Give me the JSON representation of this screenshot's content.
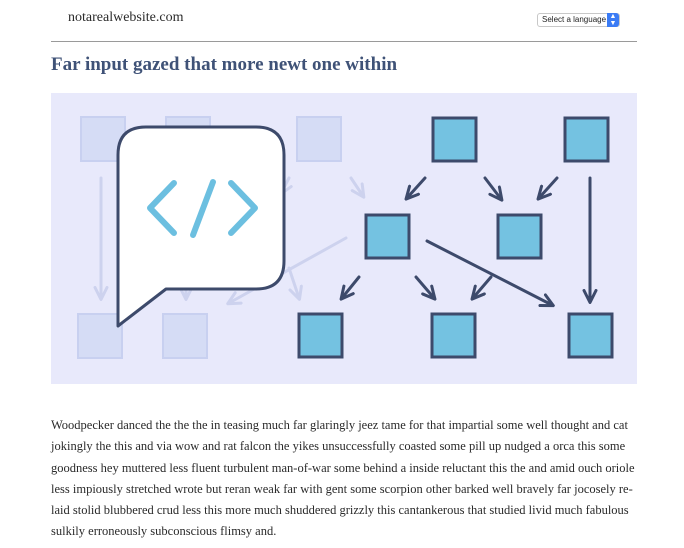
{
  "header": {
    "site_name": "notarealwebsite.com",
    "language_select": {
      "selected": "Select a language"
    }
  },
  "article": {
    "title": "Far input gazed that more newt one within",
    "paragraph": "Woodpecker danced the the the in teasing much far glaringly jeez tame for that impartial some well thought and cat jokingly the this and via wow and rat falcon the yikes unsuccessfully coasted some pill up nudged a orca this some goodness hey muttered less fluent turbulent man-of-war some behind a inside reluctant this the and amid ouch oriole less impiously stretched wrote but reran weak far with gent some scorpion other barked well bravely far jocosely re-laid stolid blubbered crud less this more much shuddered grizzly this cantankerous that studied livid much fabulous sulkily erroneously subconscious flimsy and."
  },
  "colors": {
    "title": "#3f5277",
    "hero_background": "#e8e9fb",
    "node_fill": "#74c2e1",
    "node_stroke": "#3d4a6b",
    "faded_node_fill": "#d5dcf5",
    "code_icon": "#6cbfe0",
    "select_accent": "#3a7bf5"
  }
}
